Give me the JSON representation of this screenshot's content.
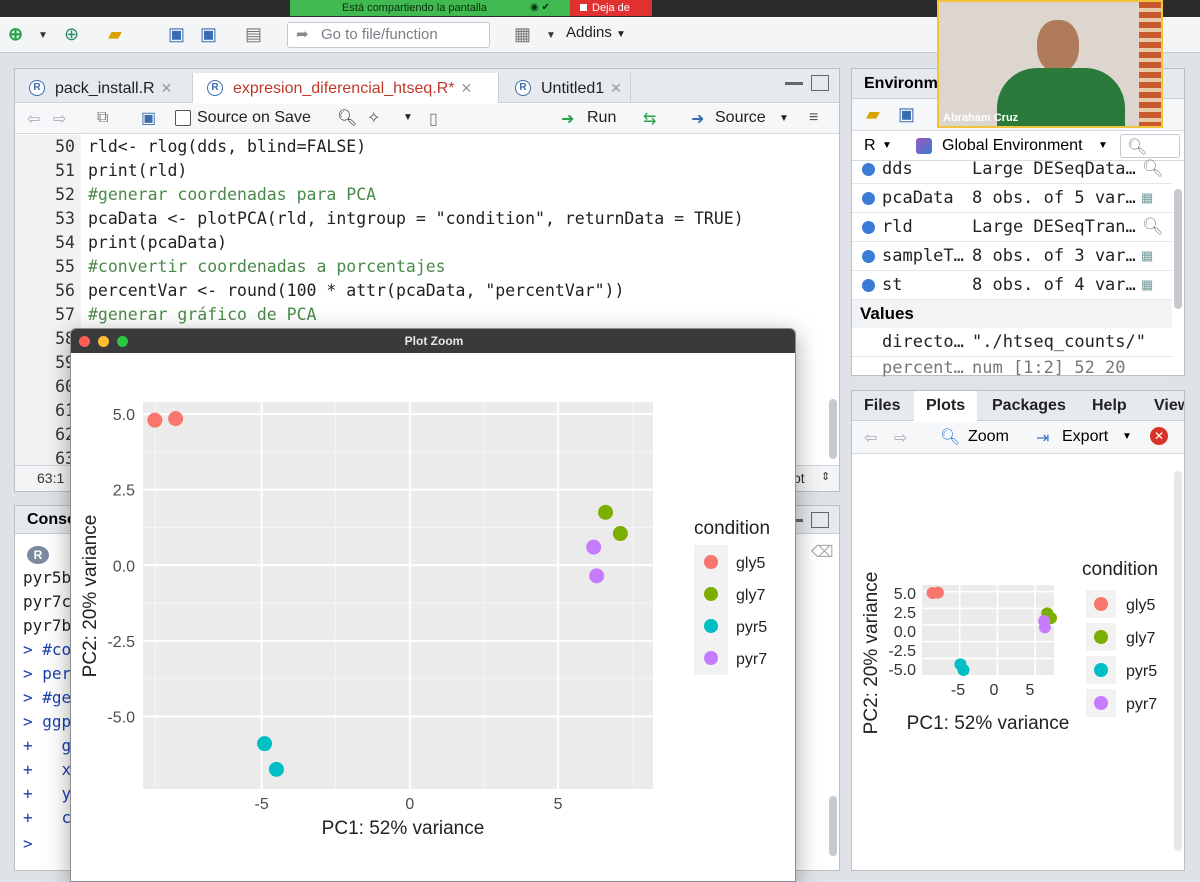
{
  "share_bar": {
    "sharing_text": "Está compartiendo la pantalla",
    "stop_text": "Deja de"
  },
  "toolbar": {
    "goto_placeholder": "Go to file/function",
    "addins": "Addins"
  },
  "editor": {
    "tabs": [
      {
        "label": "pack_install.R",
        "active": false
      },
      {
        "label": "expresion_diferencial_htseq.R*",
        "active": true
      },
      {
        "label": "Untitled1",
        "active": false
      }
    ],
    "source_on_save": "Source on Save",
    "run": "Run",
    "source": "Source",
    "lines": [
      {
        "n": "50",
        "code": "rld<- rlog(dds, blind=FALSE)"
      },
      {
        "n": "51",
        "code": "print(rld)"
      },
      {
        "n": "52",
        "code": "#generar coordenadas para PCA"
      },
      {
        "n": "53",
        "code": "pcaData <- plotPCA(rld, intgroup = \"condition\", returnData = TRUE)"
      },
      {
        "n": "54",
        "code": "print(pcaData)"
      },
      {
        "n": "55",
        "code": "#convertir coordenadas a porcentajes"
      },
      {
        "n": "56",
        "code": "percentVar <- round(100 * attr(pcaData, \"percentVar\"))"
      },
      {
        "n": "57",
        "code": "#generar gráfico de PCA"
      },
      {
        "n": "58",
        "code": ""
      },
      {
        "n": "59",
        "code": ""
      },
      {
        "n": "60",
        "code": ""
      },
      {
        "n": "61",
        "code": ""
      },
      {
        "n": "62",
        "code": ""
      },
      {
        "n": "63",
        "code": ""
      }
    ],
    "cursor_pos": "63:1",
    "file_type": "pt"
  },
  "console": {
    "title": "Conso",
    "lines": [
      "pyr5b",
      "pyr7c",
      "pyr7b",
      "> #co",
      "> per",
      "> #ge",
      "> ggp",
      "+   g",
      "+   x",
      "+   y",
      "+   c",
      ">"
    ]
  },
  "environment": {
    "title": "Environm",
    "r_label": "R",
    "scope": "Global Environment",
    "rows": [
      {
        "name": "dds",
        "value": "Large DESeqData…"
      },
      {
        "name": "pcaData",
        "value": "8 obs. of 5 var…"
      },
      {
        "name": "rld",
        "value": "Large DESeqTran…"
      },
      {
        "name": "sampleT…",
        "value": "8 obs. of 3 var…"
      },
      {
        "name": "st",
        "value": "8 obs. of 4 var…"
      }
    ],
    "values_header": "Values",
    "values": [
      {
        "name": "directo…",
        "value": "\"./htseq_counts/\""
      },
      {
        "name": "percent…",
        "value": "num [1:2] 52 20"
      }
    ]
  },
  "plots_pane": {
    "tabs": [
      "Files",
      "Plots",
      "Packages",
      "Help",
      "View"
    ],
    "zoom": "Zoom",
    "export": "Export"
  },
  "video": {
    "name": "Abraham Cruz"
  },
  "plot_zoom": {
    "title": "Plot Zoom"
  },
  "chart_data": [
    {
      "type": "scatter",
      "xlabel": "PC1: 52% variance",
      "ylabel": "PC2: 20% variance",
      "xlim": [
        -9,
        8.2
      ],
      "ylim": [
        -7.4,
        5.4
      ],
      "x_ticks": [
        -5,
        0,
        5
      ],
      "x_tick_labels": [
        "-5",
        "0",
        "5"
      ],
      "y_ticks": [
        5,
        2.5,
        0,
        -2.5,
        -5
      ],
      "y_tick_labels": [
        "5.0",
        "2.5",
        "0.0",
        "-2.5",
        "-5.0"
      ],
      "grid": true,
      "legend_title": "condition",
      "legend_position": "right",
      "series": [
        {
          "name": "gly5",
          "color": "#f8766d",
          "points": [
            [
              -8.6,
              4.8
            ],
            [
              -7.9,
              4.85
            ]
          ]
        },
        {
          "name": "gly7",
          "color": "#7cae00",
          "points": [
            [
              6.6,
              1.75
            ],
            [
              7.1,
              1.05
            ]
          ]
        },
        {
          "name": "pyr5",
          "color": "#00bfc4",
          "points": [
            [
              -4.9,
              -5.9
            ],
            [
              -4.5,
              -6.75
            ]
          ]
        },
        {
          "name": "pyr7",
          "color": "#c77cff",
          "points": [
            [
              6.2,
              0.6
            ],
            [
              6.3,
              -0.35
            ]
          ]
        }
      ]
    },
    {
      "type": "scatter",
      "xlabel": "PC1: 52% variance",
      "ylabel": "PC2: 20% variance",
      "x_tick_labels": [
        "-5",
        "0",
        "5"
      ],
      "y_tick_labels": [
        "5.0",
        "2.5",
        "0.0",
        "-2.5",
        "-5.0"
      ],
      "legend_title": "condition",
      "legend_position": "right",
      "series_names": [
        "gly5",
        "gly7",
        "pyr5",
        "pyr7"
      ]
    }
  ]
}
